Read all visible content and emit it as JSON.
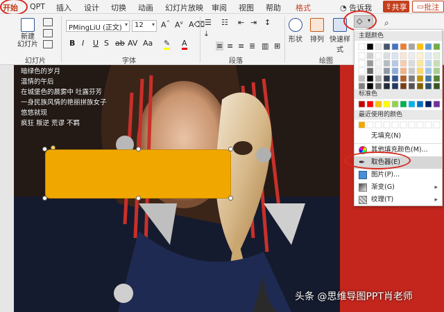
{
  "tabs": [
    {
      "label": "开始",
      "active": true
    },
    {
      "label": "QPT"
    },
    {
      "label": "插入"
    },
    {
      "label": "设计"
    },
    {
      "label": "切换"
    },
    {
      "label": "动画"
    },
    {
      "label": "幻灯片放映"
    },
    {
      "label": "审阅"
    },
    {
      "label": "视图"
    },
    {
      "label": "帮助"
    },
    {
      "label": "格式",
      "contextual": true
    },
    {
      "label": "告诉我"
    }
  ],
  "share_label": "共享",
  "comments_label": "批注",
  "ribbon": {
    "new_slide_label": "新建\n幻灯片",
    "slides_group": "幻灯片",
    "font_group": "字体",
    "paragraph_group": "段落",
    "drawing_group": "绘图",
    "font_name": "PMingLiU (正文)",
    "font_size": "12",
    "format_buttons": [
      "B",
      "I",
      "U",
      "S",
      "ab",
      "AV",
      "Aa",
      "A"
    ],
    "shapes_label": "形状",
    "arrange_label": "排列",
    "quick_styles_label": "快速样式"
  },
  "poem_lines": [
    "暗绿色的岁月",
    "温情的午后",
    "在城堡色的晨雾中 吐露芬芳",
    "一身民族风情的艳丽拼族女子",
    "悠悠就现",
    "疯狂 叛逆 荒谬 不羁"
  ],
  "dropdown": {
    "theme_colors_label": "主题颜色",
    "standard_colors_label": "标准色",
    "recent_colors_label": "最近使用的颜色",
    "no_fill_label": "无填充(N)",
    "more_fill_label": "其他填充颜色(M)...",
    "eyedropper_label": "取色器(E)",
    "picture_label": "图片(P)...",
    "gradient_label": "渐变(G)",
    "texture_label": "纹理(T)",
    "theme_top_row": [
      "#ffffff",
      "#000000",
      "#e7e6e6",
      "#44546a",
      "#4472c4",
      "#ed7d31",
      "#a5a5a5",
      "#ffc000",
      "#5b9bd5",
      "#70ad47"
    ],
    "standard_colors": [
      "#c00000",
      "#ff0000",
      "#ffc000",
      "#ffff00",
      "#92d050",
      "#00b050",
      "#00b0f0",
      "#0070c0",
      "#002060",
      "#7030a0"
    ],
    "recent_colors": [
      "#f0a800",
      "#ffffff",
      "#ffffff",
      "#ffffff",
      "#ffffff",
      "#ffffff",
      "#ffffff",
      "#ffffff",
      "#ffffff",
      "#ffffff"
    ]
  },
  "shape_fill_color": "#f0a800",
  "watermark": "头条 @思维导图PPT肖老师",
  "accent_color": "#c43e1c",
  "annotation_color": "#d62a20"
}
